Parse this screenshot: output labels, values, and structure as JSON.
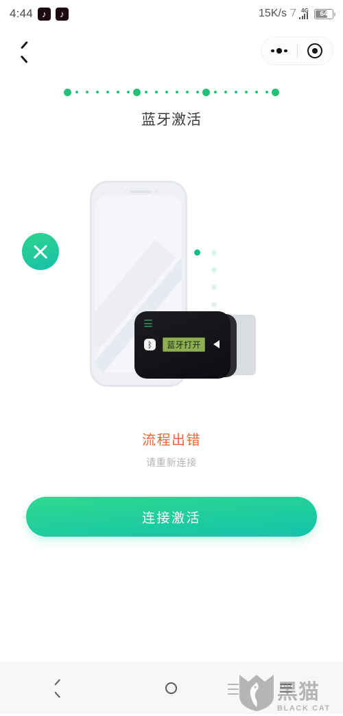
{
  "statusbar": {
    "clock": "4:44",
    "app_icons": [
      "tiktok-icon",
      "tiktok-icon"
    ],
    "network_speed": "15K/s",
    "bluetooth_icon": "bluetooth-icon",
    "network_type": "4G",
    "battery_level": "64"
  },
  "navbar": {
    "back_icon": "chevron-left-icon",
    "menu_icon": "more-options-icon",
    "close_icon": "target-circle-icon"
  },
  "progress": {
    "total_steps": 4,
    "current_step": 4,
    "dots_between": 6,
    "color": "#22c176"
  },
  "page": {
    "title": "蓝牙激活"
  },
  "illustration": {
    "phone_icon": "smartphone-illustration",
    "status_icon": "error-cross-icon",
    "device_icon": "bluetooth-dongle-illustration",
    "device_bt_icon": "bluetooth-icon",
    "device_bt_glyph": "ᛒ",
    "device_screen_text": "蓝牙打开",
    "device_arrow_icon": "triangle-left-icon",
    "signal_dots_icon": "signal-dots-icon"
  },
  "status": {
    "error_title": "流程出错",
    "error_subtitle": "请重新连接",
    "error_color": "#f2653a",
    "subtitle_color": "#b4b4b4"
  },
  "cta": {
    "label": "连接激活",
    "gradient_from": "#2fd98e",
    "gradient_to": "#13c3ab"
  },
  "sysnav": {
    "back_icon": "nav-back-icon",
    "home_icon": "nav-home-icon",
    "recents_icon": "nav-recents-icon"
  },
  "watermark": {
    "cn": "黑猫",
    "en": "BLACK CAT",
    "logo_icon": "black-cat-shield-logo"
  }
}
